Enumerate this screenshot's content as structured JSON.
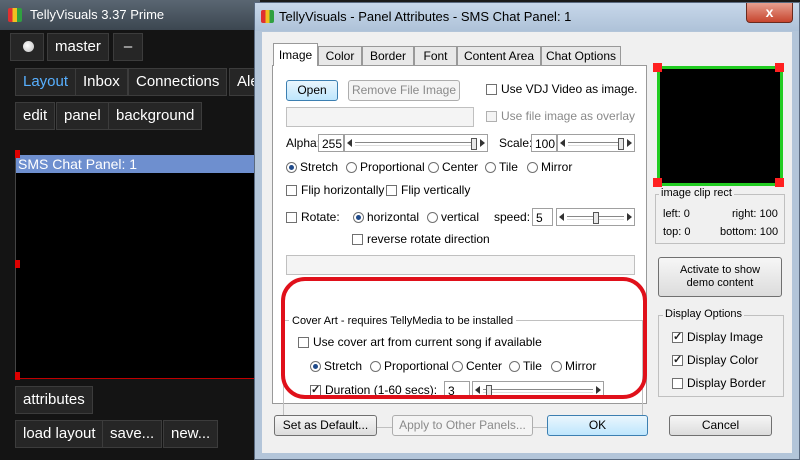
{
  "app": {
    "title": "TellyVisuals 3.37 Prime",
    "master_label": "master",
    "minus_label": "–",
    "main_tabs": [
      "Layout",
      "Inbox",
      "Connections",
      "Ale"
    ],
    "sub_tabs": [
      "edit",
      "panel",
      "background"
    ],
    "panel_list_item": "SMS Chat Panel: 1",
    "attributes_button": "attributes",
    "load_layout_button": "load layout",
    "save_button": "save...",
    "new_button": "new..."
  },
  "dialog": {
    "title": "TellyVisuals - Panel Attributes - SMS Chat Panel: 1",
    "close_glyph": "x",
    "tabs": [
      "Image",
      "Color",
      "Border",
      "Font",
      "Content Area",
      "Chat Options"
    ],
    "active_tab": "Image",
    "image_tab": {
      "open_button": "Open",
      "remove_button": "Remove File Image",
      "use_vdj_label": "Use VDJ Video as image.",
      "use_overlay_label": "Use file image as overlay",
      "alpha_label": "Alpha:",
      "alpha_value": "255",
      "alpha_level": 1.0,
      "scale_label": "Scale:",
      "scale_value": "100",
      "scale_level": 1.0,
      "fit_options": [
        "Stretch",
        "Proportional",
        "Center",
        "Tile",
        "Mirror"
      ],
      "fit_selected": "Stretch",
      "flip_h_label": "Flip horizontally",
      "flip_v_label": "Flip vertically",
      "rotate_label": "Rotate:",
      "rotate_h_label": "horizontal",
      "rotate_v_label": "vertical",
      "speed_label": "speed:",
      "speed_value": "5",
      "speed_level": 0.5,
      "reverse_label": "reverse rotate direction",
      "cover_art": {
        "legend": "Cover Art - requires TellyMedia to be installed",
        "use_cover_label": "Use cover art from current song if available",
        "fit_options": [
          "Stretch",
          "Proportional",
          "Center",
          "Tile",
          "Mirror"
        ],
        "fit_selected": "Stretch",
        "duration_label": "Duration (1-60 secs):",
        "duration_value": "3",
        "duration_level": 0.03
      }
    },
    "right_panel": {
      "clip_rect_label": "image clip rect",
      "left_label": "left: 0",
      "right_label": "right: 100",
      "top_label": "top: 0",
      "bottom_label": "bottom: 100",
      "activate_line1": "Activate to show",
      "activate_line2": "demo content",
      "display_options_legend": "Display Options",
      "display_image": "Display Image",
      "display_color": "Display Color",
      "display_border": "Display Border"
    },
    "footer": {
      "set_default": "Set as Default...",
      "apply_other": "Apply to Other Panels...",
      "ok": "OK",
      "cancel": "Cancel"
    }
  },
  "colors": {
    "annotation_outline": "#e0101a",
    "preview_border": "#22cc22",
    "preview_handles": "#ff2020",
    "selected_item": "#6e8fcf"
  }
}
